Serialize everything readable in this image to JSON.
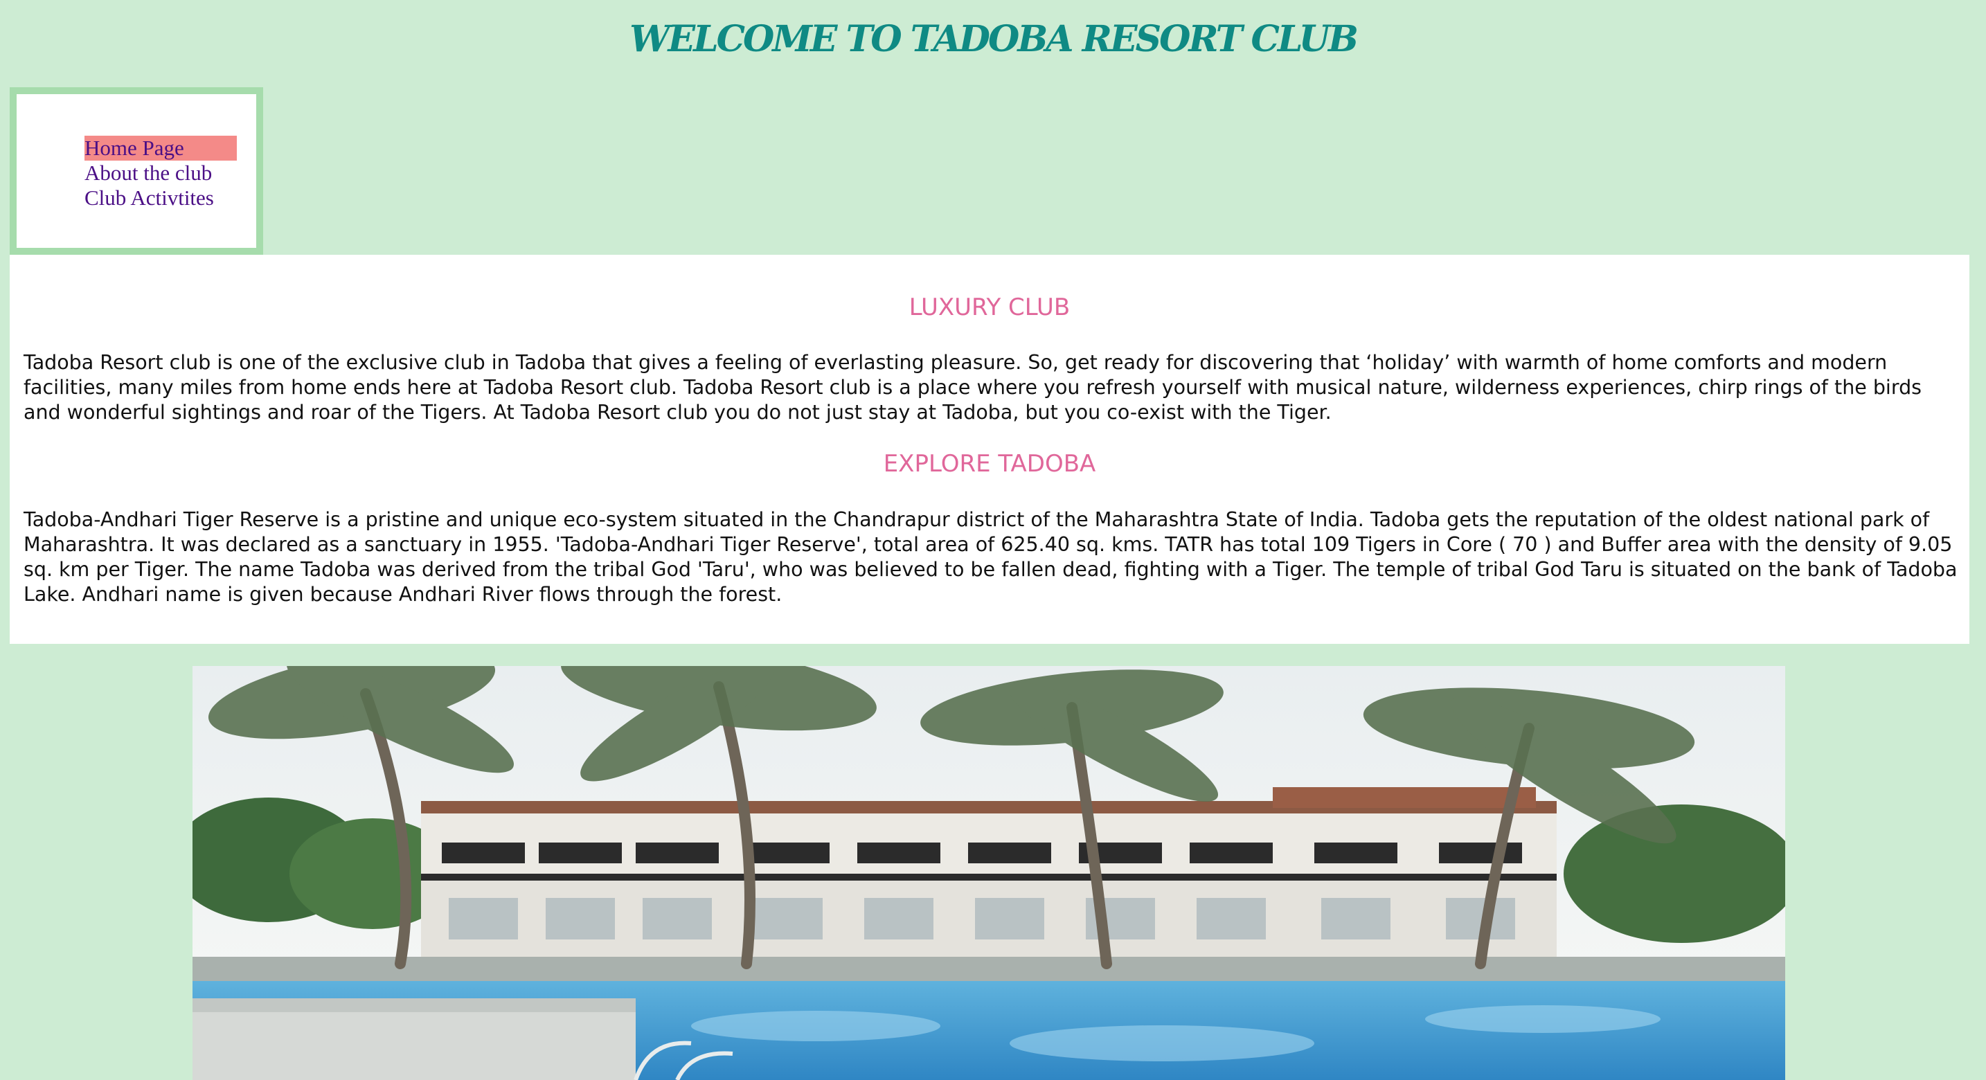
{
  "header": {
    "title": "WELCOME TO TADOBA RESORT CLUB"
  },
  "nav": {
    "items": [
      {
        "label": "Home Page",
        "active": true
      },
      {
        "label": "About the club",
        "active": false
      },
      {
        "label": "Club Activtites",
        "active": false
      }
    ]
  },
  "sections": [
    {
      "heading": "LUXURY CLUB",
      "text": "Tadoba Resort club is one of the exclusive club in Tadoba that gives a feeling of everlasting pleasure. So, get ready for discovering that ‘holiday’ with warmth of home comforts and modern facilities, many miles from home ends here at Tadoba Resort club. Tadoba Resort club is a place where you refresh yourself with musical nature, wilderness experiences, chirp rings of the birds and wonderful sightings and roar of the Tigers. At Tadoba Resort club you do not just stay at Tadoba, but you co-exist with the Tiger."
    },
    {
      "heading": "EXPLORE TADOBA",
      "text": "Tadoba-Andhari Tiger Reserve is a pristine and unique eco-system situated in the Chandrapur district of the Maharashtra State of India. Tadoba gets the reputation of the oldest national park of Maharashtra. It was declared as a sanctuary in 1955. 'Tadoba-Andhari Tiger Reserve', total area of 625.40 sq. kms. TATR has total 109 Tigers in Core ( 70 ) and Buffer area with the density of 9.05 sq. km per Tiger. The name Tadoba was derived from the tribal God 'Taru', who was believed to be fallen dead, fighting with a Tiger. The temple of tribal God Taru is situated on the bank of Tadoba Lake. Andhari name is given because Andhari River flows through the forest."
    }
  ],
  "colors": {
    "page_background": "#cdecd3",
    "title": "#0f8a84",
    "nav_border": "#a6dcac",
    "nav_active": "#f48a88",
    "nav_link": "#4b0f86",
    "section_heading": "#e0679a",
    "body_text": "#111111"
  }
}
